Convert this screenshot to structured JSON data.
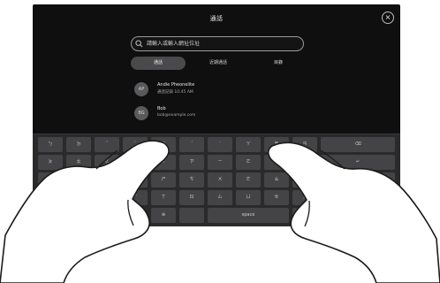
{
  "header": {
    "title": "通話",
    "close_icon": "×"
  },
  "search": {
    "placeholder": "請輸入或輸入網址位址"
  },
  "tabs": [
    {
      "label": "通話"
    },
    {
      "label": "近期通話"
    },
    {
      "label": "目錄"
    }
  ],
  "contacts": [
    {
      "initials": "AP",
      "name": "Andie Pheonelite",
      "detail": "通話記錄 10:45 AM"
    },
    {
      "initials": "BG",
      "name": "Bob",
      "detail": "bob@example.com"
    }
  ],
  "keyboard": {
    "row1": [
      "ㄅ",
      "ㄉ",
      "ˇ",
      "ˋ",
      "ㄓ",
      "ˊ",
      "˙",
      "ㄚ",
      "ㄞ",
      "ㄢ",
      "⌫"
    ],
    "row2": [
      "ㄆ",
      "ㄊ",
      "ㄍ",
      "ㄐ",
      "ㄔ",
      "ㄗ",
      "ㄧ",
      "ㄛ",
      "ㄟ",
      "ㄣ",
      "↵"
    ],
    "row3": [
      "ㄇ",
      "ㄋ",
      "ㄎ",
      "ㄑ",
      "ㄕ",
      "ㄘ",
      "ㄨ",
      "ㄜ",
      "ㄠ",
      "ㄤ",
      "ㄦ"
    ],
    "row4": [
      "123",
      "ㄈ",
      "ㄌ",
      "ㄏ",
      "ㄒ",
      "ㄖ",
      "ㄙ",
      "ㄩ",
      "ㄝ",
      "ㄡ",
      "ㄥ"
    ],
    "row5": [
      "⊕",
      "",
      "space",
      "",
      "⊖"
    ]
  }
}
